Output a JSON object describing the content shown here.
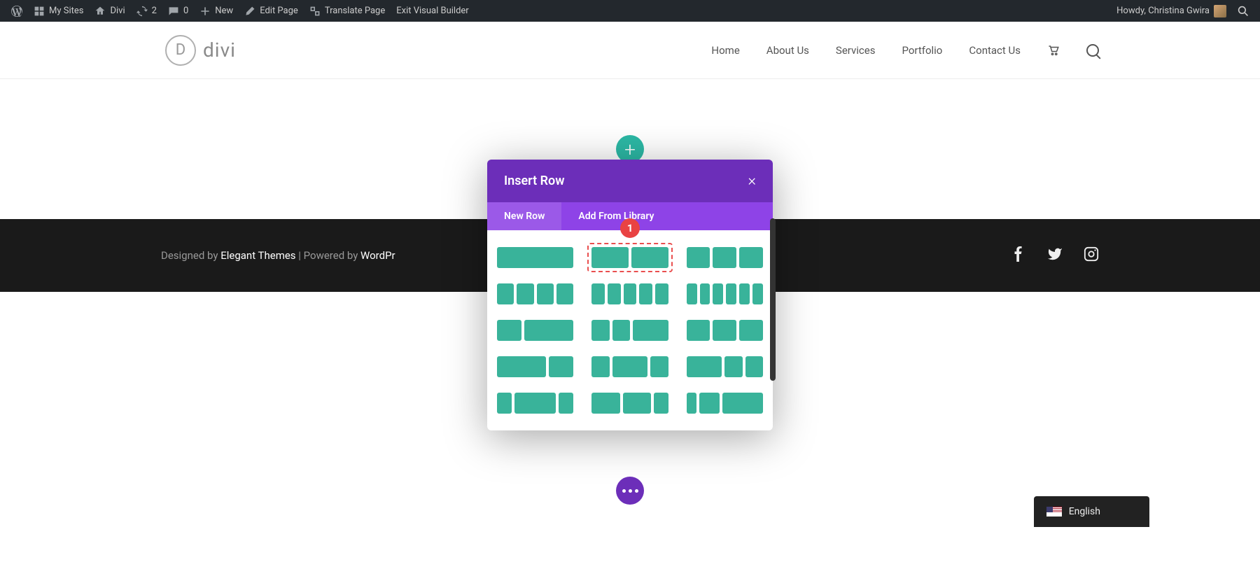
{
  "adminbar": {
    "my_sites": "My Sites",
    "site_name": "Divi",
    "updates": "2",
    "comments": "0",
    "new": "New",
    "edit_page": "Edit Page",
    "translate_page": "Translate Page",
    "exit_vb": "Exit Visual Builder",
    "howdy": "Howdy, Christina Gwira"
  },
  "header": {
    "logo_letter": "D",
    "logo_text": "divi",
    "nav": [
      "Home",
      "About Us",
      "Services",
      "Portfolio",
      "Contact Us"
    ]
  },
  "footer": {
    "designed_by": "Designed by ",
    "theme": "Elegant Themes",
    "sep": " | Powered by ",
    "platform": "WordPr"
  },
  "modal": {
    "title": "Insert Row",
    "tab_new": "New Row",
    "tab_lib": "Add From Library",
    "layouts": [
      [
        1
      ],
      [
        1,
        1
      ],
      [
        1,
        1,
        1
      ],
      [
        1,
        1,
        1,
        1
      ],
      [
        1,
        1,
        1,
        1,
        1
      ],
      [
        1,
        1,
        1,
        1,
        1,
        1
      ],
      [
        1,
        2
      ],
      [
        1,
        1,
        2
      ],
      [
        1,
        1,
        1
      ],
      [
        2,
        1
      ],
      [
        1,
        2,
        1
      ],
      [
        2,
        1,
        1
      ],
      [
        0.7,
        2,
        0.7
      ],
      [
        1,
        1,
        0.5
      ],
      [
        0.5,
        1,
        2
      ]
    ],
    "selected_index": 1
  },
  "annotation": {
    "badge": "1"
  },
  "lang": {
    "label": "English"
  }
}
